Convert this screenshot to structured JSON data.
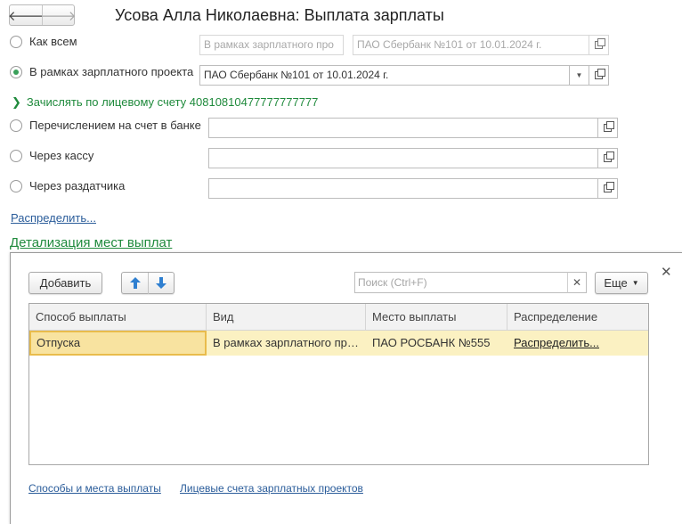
{
  "window": {
    "title": "Усова Алла Николаевна: Выплата зарплаты",
    "nav_back_glyph": "🡐",
    "nav_forward_glyph": "🡒"
  },
  "options": {
    "like_all": {
      "label": "Как всем",
      "kind_value": "В рамках зарплатного про",
      "project_value": "ПАО Сбербанк №101 от 10.01.2024 г."
    },
    "salary_project": {
      "label": "В рамках зарплатного проекта",
      "value": "ПАО Сбербанк №101 от 10.01.2024 г."
    },
    "personal_account_link": "Зачислять по лицевому счету 40810810477777777777",
    "bank_transfer": {
      "label": "Перечислением на счет в банке",
      "value": ""
    },
    "cash_desk": {
      "label": "Через кассу",
      "value": ""
    },
    "distributor": {
      "label": "Через раздатчика",
      "value": ""
    },
    "distribute_link": "Распределить..."
  },
  "details": {
    "group_title": "Детализация мест выплат",
    "add_button": "Добавить",
    "search_placeholder": "Поиск (Ctrl+F)",
    "more_button": "Еще",
    "columns": [
      "Способ выплаты",
      "Вид",
      "Место выплаты",
      "Распределение"
    ],
    "rows": [
      {
        "method": "Отпуска",
        "kind": "В рамках зарплатного проекта",
        "place": "ПАО РОСБАНК №555",
        "distribution": "Распределить..."
      }
    ],
    "footer_links": {
      "methods": "Способы и места выплаты",
      "accounts": "Лицевые счета зарплатных проектов"
    }
  },
  "colors": {
    "accent_green": "#1f8a3c",
    "link_blue": "#2a5c9a",
    "selected_row": "#fbf1c2"
  }
}
